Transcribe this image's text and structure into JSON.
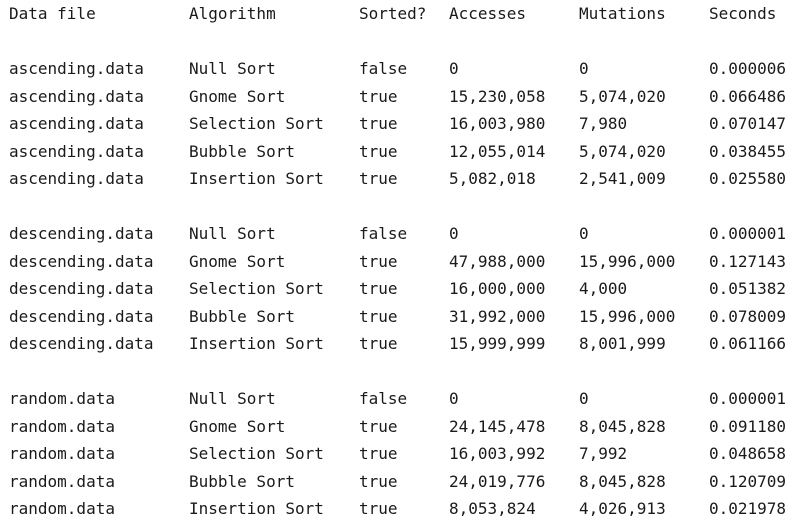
{
  "table": {
    "headers": [
      "Data file",
      "Algorithm",
      "Sorted?",
      "Accesses",
      "Mutations",
      "Seconds"
    ],
    "groups": [
      {
        "rows": [
          [
            "ascending.data",
            "Null Sort",
            "false",
            "0",
            "0",
            "0.000006"
          ],
          [
            "ascending.data",
            "Gnome Sort",
            "true",
            "15,230,058",
            "5,074,020",
            "0.066486"
          ],
          [
            "ascending.data",
            "Selection Sort",
            "true",
            "16,003,980",
            "7,980",
            "0.070147"
          ],
          [
            "ascending.data",
            "Bubble Sort",
            "true",
            "12,055,014",
            "5,074,020",
            "0.038455"
          ],
          [
            "ascending.data",
            "Insertion Sort",
            "true",
            "5,082,018",
            "2,541,009",
            "0.025580"
          ]
        ]
      },
      {
        "rows": [
          [
            "descending.data",
            "Null Sort",
            "false",
            "0",
            "0",
            "0.000001"
          ],
          [
            "descending.data",
            "Gnome Sort",
            "true",
            "47,988,000",
            "15,996,000",
            "0.127143"
          ],
          [
            "descending.data",
            "Selection Sort",
            "true",
            "16,000,000",
            "4,000",
            "0.051382"
          ],
          [
            "descending.data",
            "Bubble Sort",
            "true",
            "31,992,000",
            "15,996,000",
            "0.078009"
          ],
          [
            "descending.data",
            "Insertion Sort",
            "true",
            "15,999,999",
            "8,001,999",
            "0.061166"
          ]
        ]
      },
      {
        "rows": [
          [
            "random.data",
            "Null Sort",
            "false",
            "0",
            "0",
            "0.000001"
          ],
          [
            "random.data",
            "Gnome Sort",
            "true",
            "24,145,478",
            "8,045,828",
            "0.091180"
          ],
          [
            "random.data",
            "Selection Sort",
            "true",
            "16,003,992",
            "7,992",
            "0.048658"
          ],
          [
            "random.data",
            "Bubble Sort",
            "true",
            "24,019,776",
            "8,045,828",
            "0.120709"
          ],
          [
            "random.data",
            "Insertion Sort",
            "true",
            "8,053,824",
            "4,026,913",
            "0.021978"
          ]
        ]
      }
    ]
  }
}
